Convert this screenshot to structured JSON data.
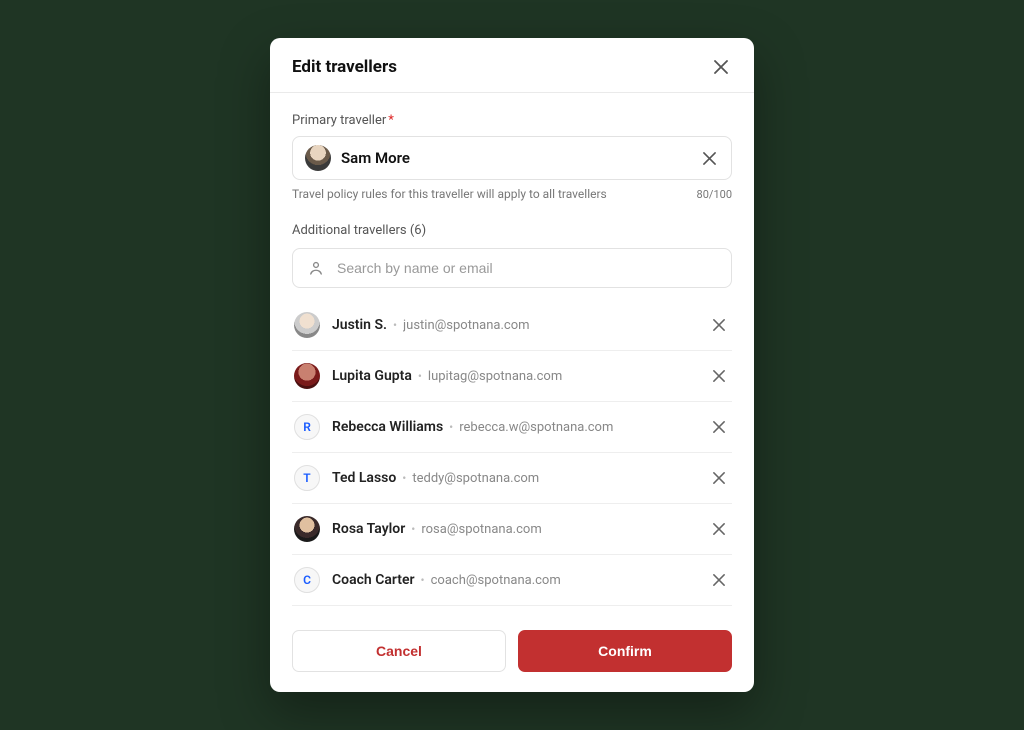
{
  "modal": {
    "title": "Edit travellers",
    "primary": {
      "label": "Primary traveller",
      "name": "Sam More",
      "helper": "Travel policy rules for this traveller will apply to all travellers",
      "counter": "80/100"
    },
    "additional": {
      "label": "Additional travellers (6)",
      "search_placeholder": "Search by name or email",
      "items": [
        {
          "name": "Justin S.",
          "email": "justin@spotnana.com",
          "avatar": "img2",
          "initial": ""
        },
        {
          "name": "Lupita Gupta",
          "email": "lupitag@spotnana.com",
          "avatar": "img3",
          "initial": ""
        },
        {
          "name": "Rebecca Williams",
          "email": "rebecca.w@spotnana.com",
          "avatar": "letter",
          "initial": "R"
        },
        {
          "name": "Ted Lasso",
          "email": "teddy@spotnana.com",
          "avatar": "letter",
          "initial": "T"
        },
        {
          "name": "Rosa Taylor",
          "email": "rosa@spotnana.com",
          "avatar": "img4",
          "initial": ""
        },
        {
          "name": "Coach Carter",
          "email": "coach@spotnana.com",
          "avatar": "letter",
          "initial": "C"
        }
      ]
    },
    "actions": {
      "cancel": "Cancel",
      "confirm": "Confirm"
    }
  }
}
